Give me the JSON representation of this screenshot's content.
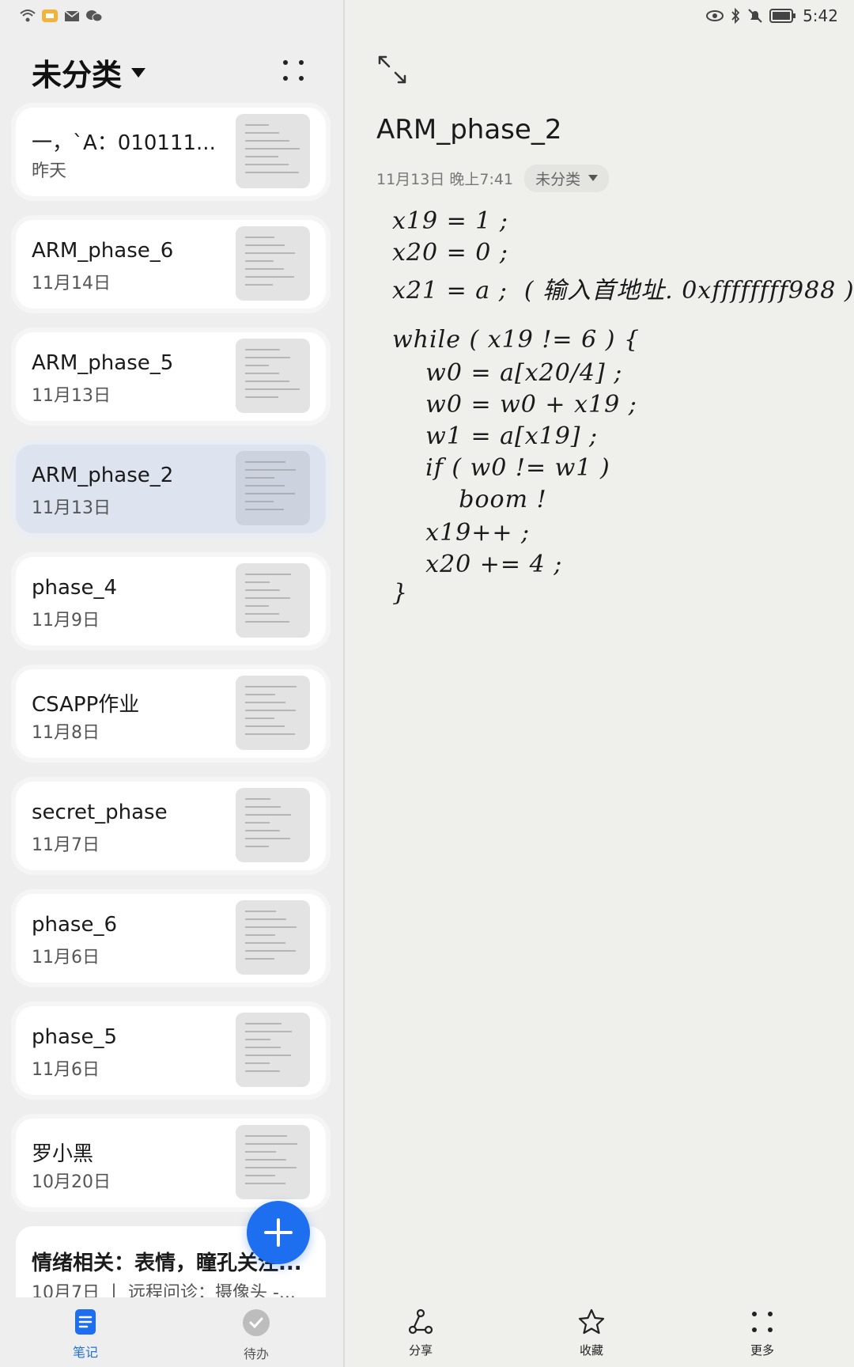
{
  "status_bar": {
    "time": "5:42"
  },
  "sidebar": {
    "folder_title": "未分类",
    "notes": [
      {
        "title": "一，`A：010111...",
        "date": "昨天"
      },
      {
        "title": "ARM_phase_6",
        "date": "11月14日"
      },
      {
        "title": "ARM_phase_5",
        "date": "11月13日"
      },
      {
        "title": "ARM_phase_2",
        "date": "11月13日",
        "active": true
      },
      {
        "title": "phase_4",
        "date": "11月9日"
      },
      {
        "title": "CSAPP作业",
        "date": "11月8日"
      },
      {
        "title": "secret_phase",
        "date": "11月7日"
      },
      {
        "title": "phase_6",
        "date": "11月6日"
      },
      {
        "title": "phase_5",
        "date": "11月6日"
      },
      {
        "title": "罗小黑",
        "date": "10月20日"
      }
    ],
    "last_note": {
      "title": "情绪相关：表情，瞳孔关注...",
      "date": "10月7日 丨 远程问诊：摄像头 -..."
    }
  },
  "bottom_nav": {
    "notes_label": "笔记",
    "todo_label": "待办"
  },
  "editor": {
    "title": "ARM_phase_2",
    "timestamp": "11月13日 晚上7:41",
    "folder": "未分类",
    "handwriting_lines": [
      "x19 = 1 ;",
      "x20 = 0 ;",
      "x21 = a ;  ( 输入首地址. 0xffffffff988 )",
      "while ( x19 != 6 ) {",
      "    w0 = a[x20/4] ;",
      "    w0 = w0 + x19 ;",
      "    w1 = a[x19] ;",
      "    if ( w0 != w1 )",
      "        boom !",
      "    x19++ ;",
      "    x20 += 4 ;",
      "}"
    ]
  },
  "toolbar": {
    "share_label": "分享",
    "favorite_label": "收藏",
    "more_label": "更多"
  },
  "colors": {
    "accent": "#1e6ef0",
    "active_card": "#dde3ef"
  }
}
